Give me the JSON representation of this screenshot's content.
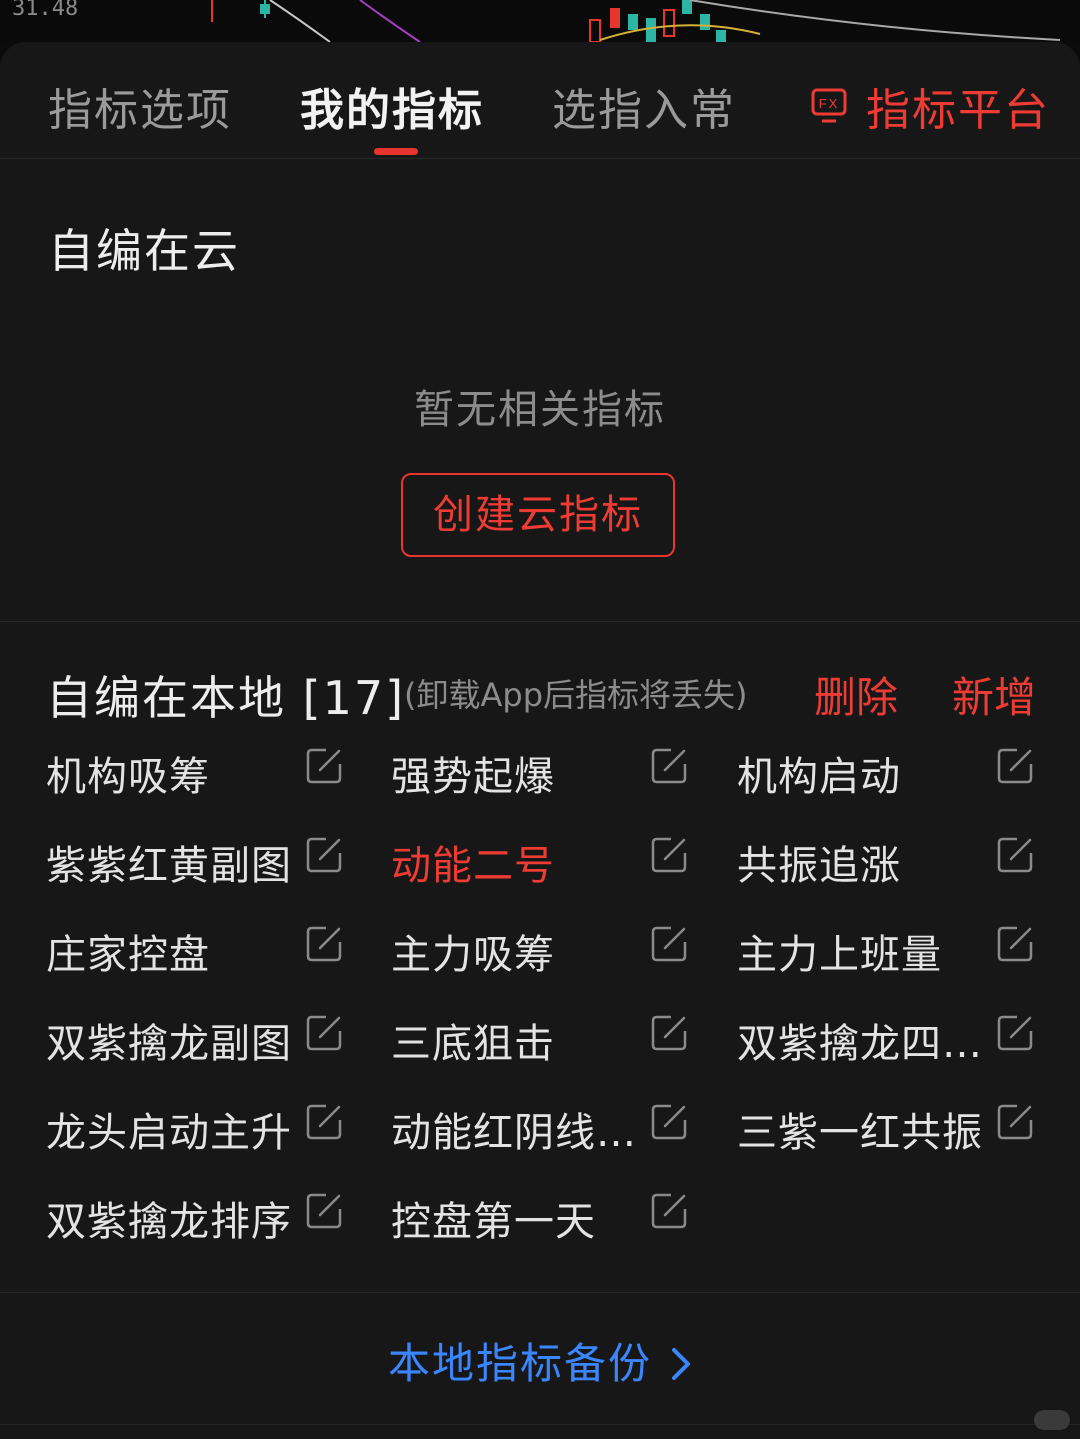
{
  "chart_strip": {
    "price_label": "31.48"
  },
  "tabs": [
    {
      "label": "指标选项",
      "active": false
    },
    {
      "label": "我的指标",
      "active": true
    },
    {
      "label": "选指入常",
      "active": false
    }
  ],
  "platform": {
    "label": "指标平台",
    "icon": "fx-screen-icon",
    "icon_text": "FX"
  },
  "cloud_section": {
    "title": "自编在云",
    "empty_text": "暂无相关指标",
    "create_button": "创建云指标"
  },
  "local_section": {
    "title": "自编在本地 [17]",
    "note": "(卸载App后指标将丢失)",
    "delete_label": "删除",
    "add_label": "新增",
    "items": [
      {
        "name": "机构吸筹",
        "highlighted": false
      },
      {
        "name": "强势起爆",
        "highlighted": false
      },
      {
        "name": "机构启动",
        "highlighted": false
      },
      {
        "name": "紫紫红黄副图",
        "highlighted": false
      },
      {
        "name": "动能二号",
        "highlighted": true
      },
      {
        "name": "共振追涨",
        "highlighted": false
      },
      {
        "name": "庄家控盘",
        "highlighted": false
      },
      {
        "name": "主力吸筹",
        "highlighted": false
      },
      {
        "name": "主力上班量",
        "highlighted": false
      },
      {
        "name": "双紫擒龙副图",
        "highlighted": false
      },
      {
        "name": "三底狙击",
        "highlighted": false
      },
      {
        "name": "双紫擒龙四…",
        "highlighted": false
      },
      {
        "name": "龙头启动主升",
        "highlighted": false
      },
      {
        "name": "动能红阴线…",
        "highlighted": false
      },
      {
        "name": "三紫一红共振",
        "highlighted": false
      },
      {
        "name": "双紫擒龙排序",
        "highlighted": false
      },
      {
        "name": "控盘第一天",
        "highlighted": false
      }
    ]
  },
  "backup": {
    "label": "本地指标备份",
    "icon": "chevron-right-icon"
  },
  "colors": {
    "accent_red": "#ee3b33",
    "link_blue": "#3a86ff",
    "panel_bg": "#171717"
  }
}
